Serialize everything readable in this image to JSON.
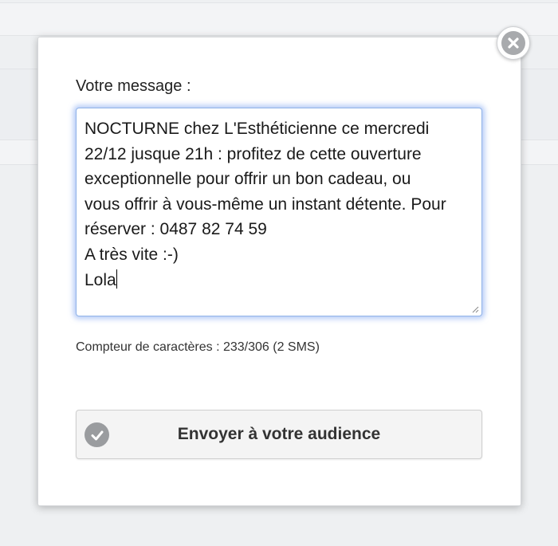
{
  "dialog": {
    "message_label": "Votre message :",
    "message_text": "NOCTURNE chez L'Esthéticienne ce mercredi\n22/12 jusque 21h : profitez de cette ouverture\nexceptionnelle pour offrir un bon cadeau, ou\nvous offrir à vous-même un instant détente. Pour\nréserver : 0487 82 74 59\nA très vite :-)\nLola",
    "counter_text": "Compteur de caractères : 233/306 (2 SMS)",
    "send_label": "Envoyer à votre audience"
  },
  "icons": {
    "close": "close-icon",
    "send": "check-circle-icon",
    "resize": "resize-grip-icon"
  },
  "colors": {
    "focus_glow": "#8fb2e8",
    "icon_gray": "#9a9c9f",
    "button_bg": "#f4f4f4"
  }
}
